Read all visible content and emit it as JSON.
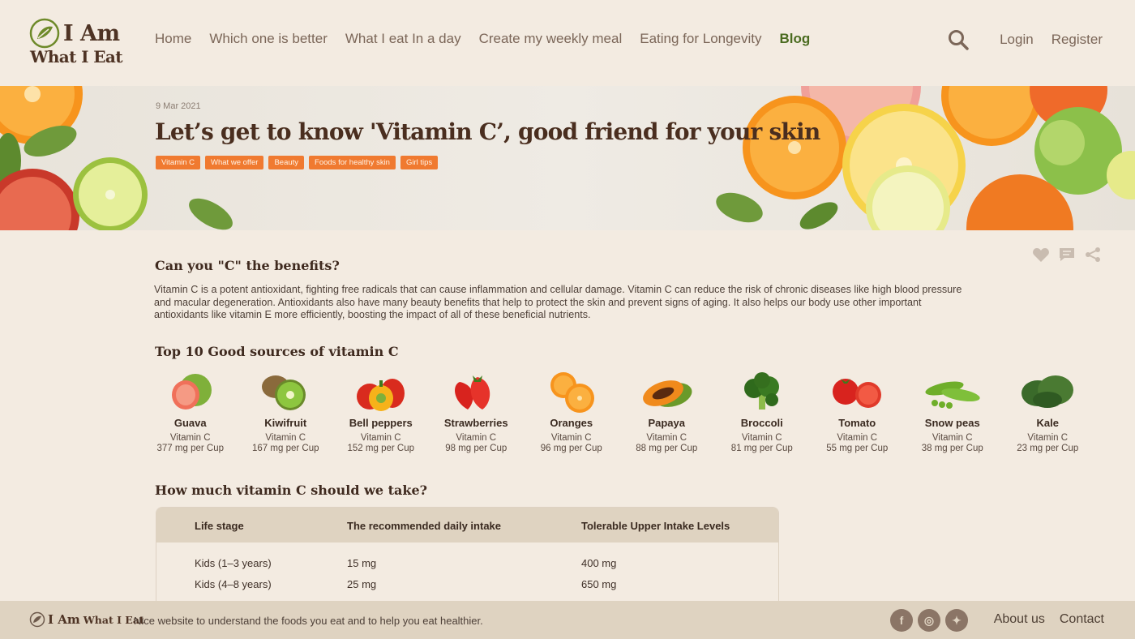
{
  "brand": {
    "line1": "I Am",
    "line2": "What I Eat",
    "footer_line1": "I Am",
    "footer_line2": "What I Eat"
  },
  "nav": {
    "items": [
      {
        "label": "Home"
      },
      {
        "label": "Which one is better"
      },
      {
        "label": "What I eat In a day"
      },
      {
        "label": "Create my weekly meal"
      },
      {
        "label": "Eating for Longevity"
      },
      {
        "label": "Blog"
      }
    ],
    "login": "Login",
    "register": "Register"
  },
  "article": {
    "date": "9 Mar 2021",
    "title": "Let’s get to know 'Vitamin C’, good friend for your skin",
    "tags": [
      "Vitamin C",
      "What we offer",
      "Beauty",
      "Foods for healthy skin",
      "Girl tips"
    ],
    "section1_title": "Can you \"C\" the benefits?",
    "intro": "Vitamin C is a potent antioxidant, fighting free radicals that can cause inflammation and cellular damage. Vitamin C can reduce the risk of chronic diseases like high blood pressure and macular degeneration. Antioxidants also have many beauty benefits that help to protect the skin and prevent signs of aging. It also helps our body use other important antioxidants like vitamin E more efficiently, boosting the impact of all of these beneficial nutrients.",
    "section2_title": "Top 10  Good sources of vitamin C",
    "section3_title": "How much vitamin C should we take?"
  },
  "foods": [
    {
      "name": "Guava",
      "nutrient": "Vitamin C",
      "amount": "377 mg per Cup",
      "icon": "guava-icon"
    },
    {
      "name": "Kiwifruit",
      "nutrient": "Vitamin C",
      "amount": "167 mg per Cup",
      "icon": "kiwi-icon"
    },
    {
      "name": "Bell peppers",
      "nutrient": "Vitamin C",
      "amount": "152 mg per Cup",
      "icon": "bell-pepper-icon"
    },
    {
      "name": "Strawberries",
      "nutrient": "Vitamin C",
      "amount": "98 mg per Cup",
      "icon": "strawberry-icon"
    },
    {
      "name": "Oranges",
      "nutrient": "Vitamin C",
      "amount": "96 mg per Cup",
      "icon": "orange-icon"
    },
    {
      "name": "Papaya",
      "nutrient": "Vitamin C",
      "amount": "88 mg per Cup",
      "icon": "papaya-icon"
    },
    {
      "name": "Broccoli",
      "nutrient": "Vitamin C",
      "amount": "81 mg per Cup",
      "icon": "broccoli-icon"
    },
    {
      "name": "Tomato",
      "nutrient": "Vitamin C",
      "amount": "55 mg per Cup",
      "icon": "tomato-icon"
    },
    {
      "name": "Snow peas",
      "nutrient": "Vitamin C",
      "amount": "38 mg per Cup",
      "icon": "snow-peas-icon"
    },
    {
      "name": "Kale",
      "nutrient": "Vitamin C",
      "amount": "23 mg per Cup",
      "icon": "kale-icon"
    }
  ],
  "intake_table": {
    "headers": [
      "Life stage",
      "The recommended daily intake",
      "Tolerable Upper Intake Levels"
    ],
    "rows": [
      [
        "Kids (1–3 years)",
        "15 mg",
        "400 mg"
      ],
      [
        "Kids (4–8 years)",
        "25 mg",
        "650 mg"
      ]
    ]
  },
  "footer": {
    "tagline": "Nice website to understand the foods you eat and to help you eat healthier.",
    "about": "About us",
    "contact": "Contact"
  },
  "colors": {
    "accent": "#f07a30",
    "brand": "#4e3324",
    "active_nav": "#4a6b1f",
    "background": "#f3ebe1",
    "footer_bg": "#dfd3c1"
  }
}
